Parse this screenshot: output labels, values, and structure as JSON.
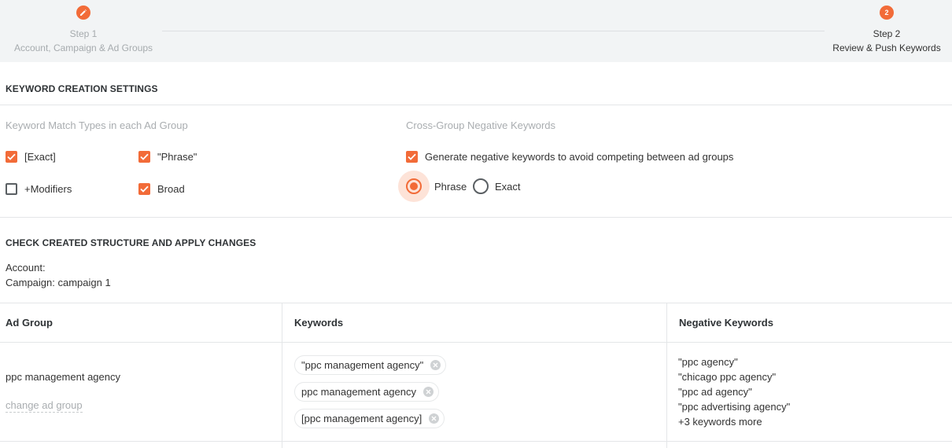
{
  "stepper": {
    "step1": {
      "label": "Step 1",
      "title": "Account, Campaign & Ad Groups",
      "icon": "pencil-icon"
    },
    "step2": {
      "number": "2",
      "label": "Step 2",
      "title": "Review & Push Keywords"
    }
  },
  "settings": {
    "title": "KEYWORD CREATION SETTINGS",
    "match_types_label": "Keyword Match Types in each Ad Group",
    "match_types": [
      {
        "label": "[Exact]",
        "checked": true
      },
      {
        "label": "\"Phrase\"",
        "checked": true
      },
      {
        "label": "+Modifiers",
        "checked": false
      },
      {
        "label": "Broad",
        "checked": true
      }
    ],
    "negatives_label": "Cross-Group Negative Keywords",
    "generate_negatives": {
      "label": "Generate negative keywords to avoid competing between ad groups",
      "checked": true
    },
    "negative_match": {
      "selected": "Phrase",
      "options": [
        "Phrase",
        "Exact"
      ]
    }
  },
  "structure": {
    "title": "CHECK CREATED STRUCTURE AND APPLY CHANGES",
    "account_line": "Account:",
    "campaign_line": "Campaign: campaign 1"
  },
  "table": {
    "headers": [
      "Ad Group",
      "Keywords",
      "Negative Keywords"
    ],
    "rows": [
      {
        "ad_group": "ppc management agency",
        "change_link": "change ad group",
        "keywords": [
          "\"ppc management agency\"",
          "ppc management agency",
          "[ppc management agency]"
        ],
        "negatives": [
          "\"ppc agency\"",
          "\"chicago ppc agency\"",
          "\"ppc ad agency\"",
          "\"ppc advertising agency\""
        ],
        "more": "+3 keywords more"
      }
    ]
  },
  "colors": {
    "accent": "#f26b38",
    "stepper_bg": "#f2f4f5",
    "muted": "#a9adb0"
  }
}
